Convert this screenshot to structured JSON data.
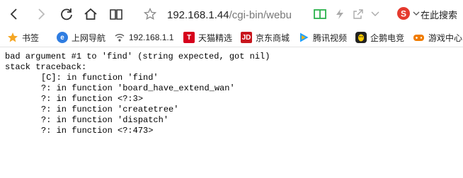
{
  "toolbar": {
    "address_host": "192.168.1.44",
    "address_path": "/cgi-bin/webu",
    "search_label": "在此搜索"
  },
  "bookmarks": [
    {
      "label": "书签",
      "icon": "star-icon"
    },
    {
      "label": "上网导航",
      "icon": "ie-icon"
    },
    {
      "label": "192.168.1.1",
      "icon": "wifi-icon"
    },
    {
      "label": "天猫精选",
      "icon": "tmall-icon"
    },
    {
      "label": "京东商城",
      "icon": "jd-icon"
    },
    {
      "label": "腾讯视频",
      "icon": "tencent-video-icon"
    },
    {
      "label": "企鹅电竞",
      "icon": "penguin-icon"
    },
    {
      "label": "游戏中心",
      "icon": "gamepad-icon"
    }
  ],
  "content": {
    "error": "bad argument #1 to 'find' (string expected, got nil)",
    "traceback_title": "stack traceback:",
    "frames": [
      "[C]: in function 'find'",
      "?: in function 'board_have_extend_wan'",
      "?: in function <?:3>",
      "?: in function 'createtree'",
      "?: in function 'dispatch'",
      "?: in function <?:473>"
    ]
  },
  "colors": {
    "accent_green": "#2bb24c",
    "search_red": "#e53a2e",
    "tmall_red": "#d6001c",
    "jd_red": "#c8161d"
  }
}
